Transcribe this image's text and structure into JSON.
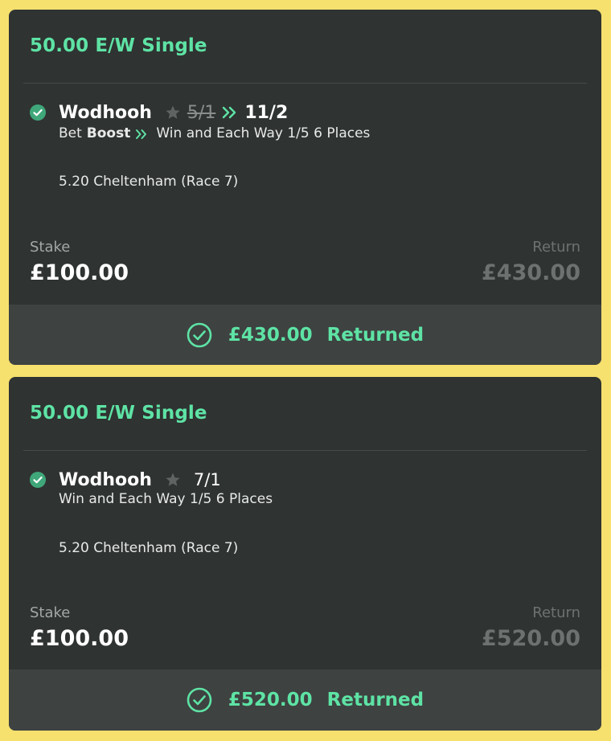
{
  "bets": [
    {
      "bet_type": "50.00 E/W Single",
      "selection": {
        "name": "Wodhooh",
        "odds_old": "5/1",
        "odds_new": "11/2",
        "boost_prefix": "Bet",
        "boost_word": "Boost",
        "terms": "Win and Each Way 1/5 6 Places"
      },
      "event": "5.20 Cheltenham (Race 7)",
      "stake_label": "Stake",
      "stake": "£100.00",
      "return_label": "Return",
      "return": "£430.00",
      "footer_amount": "£430.00",
      "footer_status": "Returned"
    },
    {
      "bet_type": "50.00 E/W Single",
      "selection": {
        "name": "Wodhooh",
        "odds": "7/1",
        "terms": "Win and Each Way 1/5 6 Places"
      },
      "event": "5.20 Cheltenham (Race 7)",
      "stake_label": "Stake",
      "stake": "£100.00",
      "return_label": "Return",
      "return": "£520.00",
      "footer_amount": "£520.00",
      "footer_status": "Returned"
    }
  ],
  "colors": {
    "background": "#f6e06e",
    "card": "#2f3332",
    "footer": "#3e4241",
    "accent_green": "#5ee3a5",
    "check_green": "#3fa77a",
    "muted": "#6d7170"
  },
  "icons": {
    "check": "check-circle-filled-icon",
    "star": "star-icon",
    "boost": "double-chevron-right-icon",
    "settled": "check-circle-outline-icon"
  }
}
